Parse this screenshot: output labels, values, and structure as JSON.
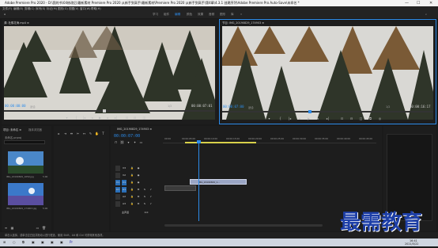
{
  "app": {
    "window_title": "Adobe Premiere Pro 2020 - D:\\我的书\\04修改后\\最新素材 Premiere Pro 2020 从新手到高手\\最新素材\\Premiere Pro 2020 从新手到高手\\第4章\\4.3.1 创建序列\\Adobe Premiere Pro Auto-Save\\未命名 *",
    "minimize": "—",
    "maximize": "☐",
    "close": "✕"
  },
  "menu": [
    "文件(F)",
    "编辑(E)",
    "剪辑(C)",
    "序列(S)",
    "标记(M)",
    "图形(G)",
    "视图(V)",
    "窗口(W)",
    "帮助(H)"
  ],
  "workspace_tabs": [
    "学习",
    "组件",
    "编辑",
    "颜色",
    "效果",
    "音频",
    "图形",
    "库",
    "»"
  ],
  "workspace_active": "编辑",
  "source_monitor": {
    "title": "源: 杜鹃花海.mp4 ≡",
    "timecode": "00:00:00:00",
    "zoom": "适合",
    "quality": "1/2",
    "duration": "00:00:07:01"
  },
  "program_monitor": {
    "title": "节目: IMG_20190829_174903 ≡",
    "timecode": "00:00:07:00",
    "zoom": "适合",
    "quality": "1/2",
    "duration": "00:00:16:17"
  },
  "project_panel": {
    "title": "项目: 未命名 ≡",
    "tab2": "媒体浏览器",
    "file": "未命名.prproj",
    "items": [
      {
        "name": "IMG_20190829_1659.jpg",
        "dur": "5:00"
      },
      {
        "name": "IMG_20190829_174903.jpg",
        "dur": "5:00"
      }
    ]
  },
  "timeline": {
    "tab": "IMG_20190829_174903 ≡",
    "timecode": "00:00:07:00",
    "ruler": [
      "00:00",
      "00:00:05:00",
      "00:00:10:00",
      "00:00:15:00",
      "00:00:20:00",
      "00:00:25:00",
      "00:00:30:00",
      "00:00:35:00",
      "00:00:40:00",
      "00:00:45:00"
    ],
    "video_tracks": [
      "V3",
      "V2",
      "V1"
    ],
    "audio_tracks": [
      "A1",
      "A2",
      "A3"
    ],
    "master": "主声道",
    "master_value": "0.0",
    "clip_label": "IMG_20190829_1..."
  },
  "status_bar": "单击以选择，或单击空白处并拖动以进行框选，使用 Shift、Alt 和 Ctrl 可获得其他选项。",
  "watermark": "最需教育",
  "taskbar": {
    "time": "16:41",
    "date": "2021/5/22"
  }
}
